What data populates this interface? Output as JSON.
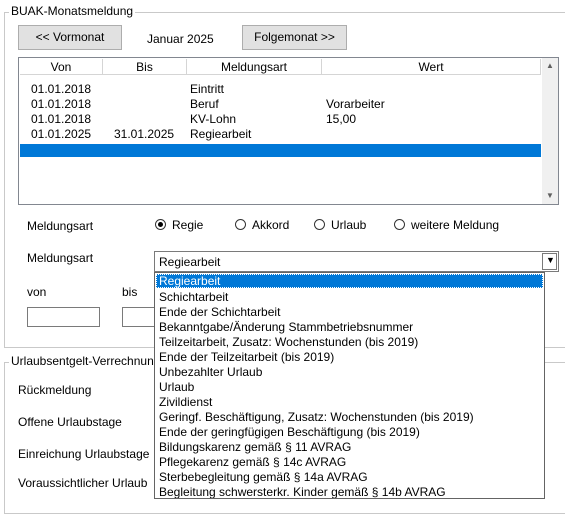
{
  "window": {
    "group_title": "BUAK-Monatsmeldung"
  },
  "nav": {
    "prev_label": "<< Vormonat",
    "month": "Januar 2025",
    "next_label": "Folgemonat >>"
  },
  "table": {
    "columns": [
      "Von",
      "Bis",
      "Meldungsart",
      "Wert"
    ],
    "rows": [
      {
        "von": "01.01.2018",
        "bis": "",
        "art": "Eintritt",
        "wert": ""
      },
      {
        "von": "01.01.2018",
        "bis": "",
        "art": "Beruf",
        "wert": "Vorarbeiter"
      },
      {
        "von": "01.01.2018",
        "bis": "",
        "art": "KV-Lohn",
        "wert": "15,00"
      },
      {
        "von": "01.01.2025",
        "bis": "31.01.2025",
        "art": "Regiearbeit",
        "wert": ""
      }
    ],
    "selected_row": 4
  },
  "type_selector": {
    "label": "Meldungsart",
    "options": [
      "Regie",
      "Akkord",
      "Urlaub",
      "weitere Meldung"
    ],
    "selected": "Regie"
  },
  "combo": {
    "label": "Meldungsart",
    "value": "Regiearbeit",
    "items": [
      "Regiearbeit",
      "Schichtarbeit",
      "Ende der Schichtarbeit",
      "Bekanntgabe/Änderung Stammbetriebsnummer",
      "Teilzeitarbeit, Zusatz: Wochenstunden (bis 2019)",
      "Ende der Teilzeitarbeit (bis 2019)",
      "Unbezahlter Urlaub",
      "Urlaub",
      "Zivildienst",
      "Geringf. Beschäftigung, Zusatz: Wochenstunden (bis 2019)",
      "Ende der geringfügigen Beschäftigung (bis 2019)",
      "Bildungskarenz gemäß § 11 AVRAG",
      "Pflegekarenz gemäß § 14c AVRAG",
      "Sterbebegleitung gemäß § 14a AVRAG",
      "Begleitung schwersterkr. Kinder gemäß § 14b AVRAG"
    ],
    "highlighted": "Regiearbeit"
  },
  "period": {
    "von_label": "von",
    "bis_label": "bis"
  },
  "vacation": {
    "group_title": "Urlaubsentgelt-Verrechnung",
    "rows": [
      "Rückmeldung",
      "Offene Urlaubstage",
      "Einreichung Urlaubstage",
      "Voraussichtlicher Urlaub"
    ]
  },
  "colors": {
    "selection": "#0078d7",
    "button_face": "#e1e1e1",
    "border": "#c9c9c9"
  }
}
